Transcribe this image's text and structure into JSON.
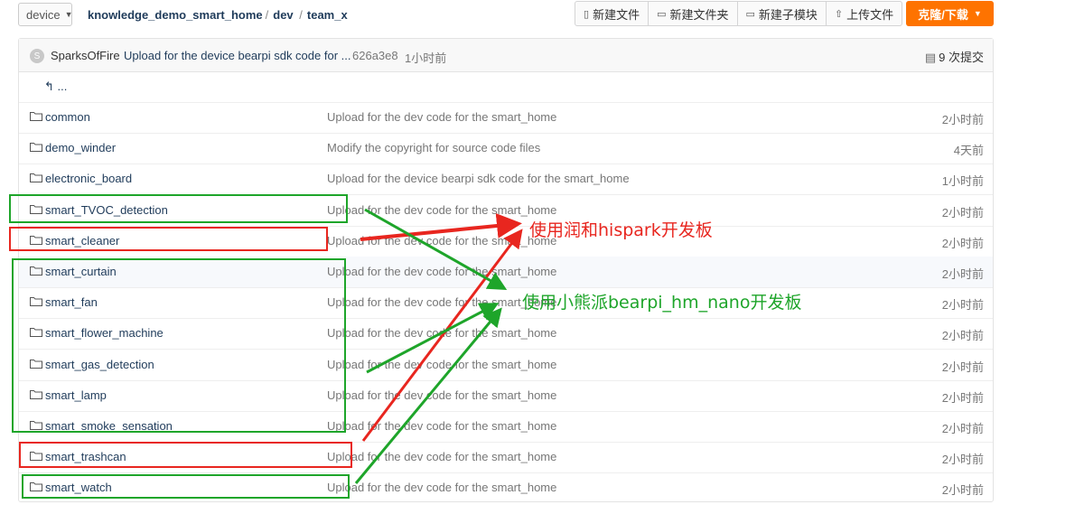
{
  "topbar": {
    "branch": "device",
    "crumbs": [
      "knowledge_demo_smart_home",
      "dev",
      "team_x"
    ],
    "buttons": [
      {
        "label": "新建文件",
        "icon": "new-file-icon"
      },
      {
        "label": "新建文件夹",
        "icon": "new-folder-icon"
      },
      {
        "label": "新建子模块",
        "icon": "new-submodule-icon"
      },
      {
        "label": "上传文件",
        "icon": "upload-icon"
      }
    ],
    "clone_label": "克隆/下载"
  },
  "commit": {
    "avatar_initial": "S",
    "author": "SparksOfFire",
    "message": "Upload for the device bearpi sdk code for ...",
    "sha": "626a3e8",
    "time": "1小时前",
    "count": "9 次提交"
  },
  "up_label": "...",
  "files": [
    {
      "name": "common",
      "message": "Upload for the dev code for the smart_home",
      "time": "2小时前"
    },
    {
      "name": "demo_winder",
      "message": "Modify the copyright for source code files",
      "time": "4天前"
    },
    {
      "name": "electronic_board",
      "message": "Upload for the device bearpi sdk code for the smart_home",
      "time": "1小时前"
    },
    {
      "name": "smart_TVOC_detection",
      "message": "Upload for the dev code for the smart_home",
      "time": "2小时前"
    },
    {
      "name": "smart_cleaner",
      "message": "Upload for the dev code for the smart_home",
      "time": "2小时前"
    },
    {
      "name": "smart_curtain",
      "message": "Upload for the dev code for the smart_home",
      "time": "2小时前"
    },
    {
      "name": "smart_fan",
      "message": "Upload for the dev code for the smart_home",
      "time": "2小时前"
    },
    {
      "name": "smart_flower_machine",
      "message": "Upload for the dev code for the smart_home",
      "time": "2小时前"
    },
    {
      "name": "smart_gas_detection",
      "message": "Upload for the dev code for the smart_home",
      "time": "2小时前"
    },
    {
      "name": "smart_lamp",
      "message": "Upload for the dev code for the smart_home",
      "time": "2小时前"
    },
    {
      "name": "smart_smoke_sensation",
      "message": "Upload for the dev code for the smart_home",
      "time": "2小时前"
    },
    {
      "name": "smart_trashcan",
      "message": "Upload for the dev code for the smart_home",
      "time": "2小时前"
    },
    {
      "name": "smart_watch",
      "message": "Upload for the dev code for the smart_home",
      "time": "2小时前"
    }
  ],
  "annotations": {
    "red_note": "使用润和hispark开发板",
    "green_note": "使用小熊派bearpi_hm_nano开发板",
    "red_color": "#e8261f",
    "green_color": "#1ea52a"
  },
  "colors": {
    "accent": "#fe7300",
    "link": "#1f3b5a"
  }
}
